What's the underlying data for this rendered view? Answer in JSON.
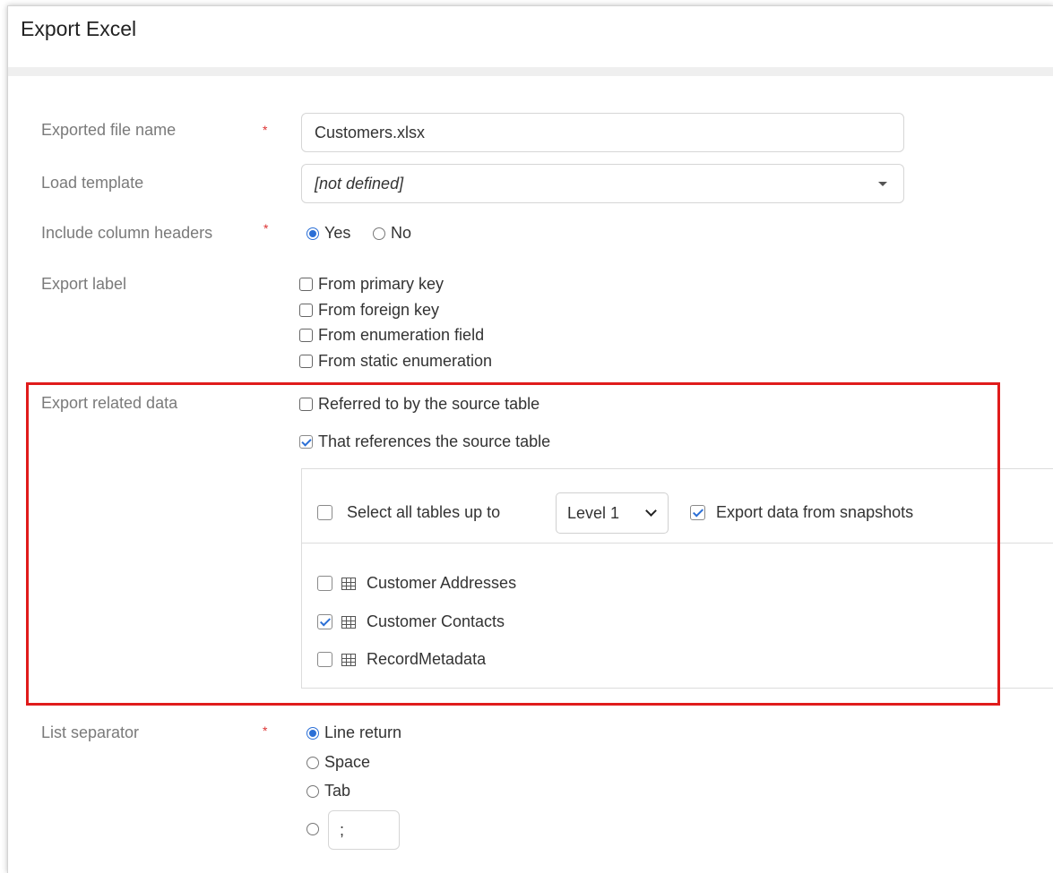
{
  "dialog": {
    "title": "Export Excel"
  },
  "form": {
    "file_name": {
      "label": "Exported file name",
      "required": "*",
      "value": "Customers.xlsx"
    },
    "template": {
      "label": "Load template",
      "value": "[not defined]"
    },
    "headers": {
      "label": "Include column headers",
      "required": "*",
      "yes": "Yes",
      "no": "No",
      "selected": "Yes"
    },
    "export_label": {
      "label": "Export label",
      "options": [
        {
          "label": "From primary key",
          "checked": false
        },
        {
          "label": "From foreign key",
          "checked": false
        },
        {
          "label": "From enumeration field",
          "checked": false
        },
        {
          "label": "From static enumeration",
          "checked": false
        }
      ]
    },
    "related": {
      "label": "Export related data",
      "referred_by": {
        "label": "Referred to by the source table",
        "checked": false
      },
      "references": {
        "label": "That references the source table",
        "checked": true
      },
      "select_all_label": "Select all tables up to",
      "level": "Level 1",
      "snapshots": {
        "label": "Export data from snapshots",
        "checked": true
      },
      "tables": [
        {
          "name": "Customer Addresses",
          "checked": false,
          "icon": "table-icon"
        },
        {
          "name": "Customer Contacts",
          "checked": true,
          "icon": "table-icon"
        },
        {
          "name": "RecordMetadata",
          "checked": false,
          "icon": "table-icon"
        }
      ]
    },
    "separator": {
      "label": "List separator",
      "required": "*",
      "options": [
        "Line return",
        "Space",
        "Tab"
      ],
      "selected": "Line return",
      "custom_value": ";"
    }
  },
  "colors": {
    "accent": "#2b6fd6",
    "highlight": "#e01b1b",
    "required": "#dd3333"
  }
}
